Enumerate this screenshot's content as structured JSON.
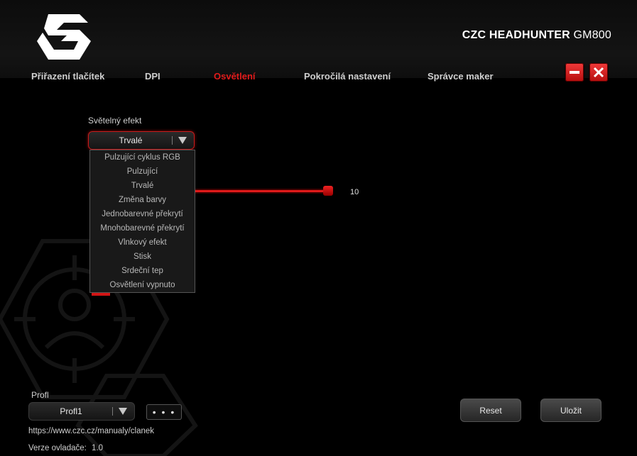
{
  "app": {
    "brand": "CZC HEADHUNTER",
    "model": "GM800"
  },
  "tabs": [
    {
      "label": "Přiřazení tlačítek"
    },
    {
      "label": "DPI"
    },
    {
      "label": "Osvětlení"
    },
    {
      "label": "Pokročilá nastavení"
    },
    {
      "label": "Správce maker"
    }
  ],
  "colors": {
    "accent": "#e21b1b",
    "background": "#000000"
  },
  "lighting": {
    "effect_label": "Světelný efekt",
    "selected_effect": "Trvalé",
    "slider_value": "10",
    "options": [
      "Pulzující cyklus RGB",
      "Pulzující",
      "Trvalé",
      "Změna barvy",
      "Jednobarevné překrytí",
      "Mnohobarevné překrytí",
      "Vlnkový efekt",
      "Stisk",
      "Srdeční tep",
      "Osvětlení vypnuto"
    ]
  },
  "profile": {
    "label": "Profl",
    "selected": "Profl1",
    "more_label": "• • •"
  },
  "buttons": {
    "reset": "Reset",
    "save": "Uložit"
  },
  "footer": {
    "url": "https://www.czc.cz/manualy/clanek",
    "driver_label": "Verze ovladače:",
    "driver_version": "1.0"
  }
}
